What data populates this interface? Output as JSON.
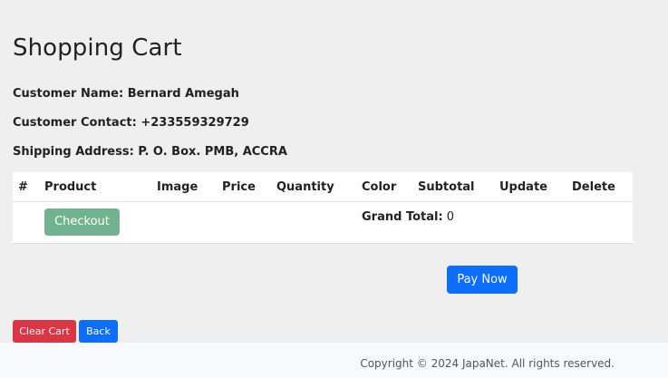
{
  "page": {
    "title": "Shopping Cart"
  },
  "customer": {
    "name_line": "Customer Name: Bernard Amegah",
    "contact_line": "Customer Contact: +233559329729",
    "address_line": "Shipping Address: P. O. Box. PMB, ACCRA"
  },
  "cart_table": {
    "headers": [
      "#",
      "Product",
      "Image",
      "Price",
      "Quantity",
      "Color",
      "Subtotal",
      "Update",
      "Delete"
    ],
    "checkout_label": "Checkout",
    "grand_total_label": "Grand Total:",
    "grand_total_value": "0"
  },
  "actions": {
    "pay_now_label": "Pay Now",
    "clear_cart_label": "Clear Cart",
    "back_label": "Back"
  },
  "colors": {
    "checkout": "#6aae8a",
    "primary": "#0d6efd",
    "danger": "#dc3545"
  },
  "footer": {
    "copyright": "Copyright © 2024 JapaNet. All rights reserved."
  }
}
